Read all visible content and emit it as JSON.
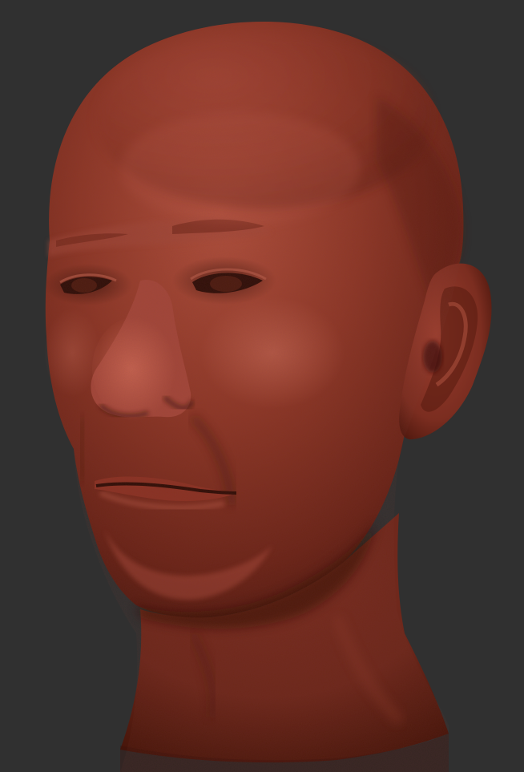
{
  "scene": {
    "subject": "sculpted-head",
    "background_color": "#303030",
    "material_base_color": "#8a3526",
    "material_highlight_color": "#c05e4a",
    "material_shadow_color": "#3e130c"
  }
}
